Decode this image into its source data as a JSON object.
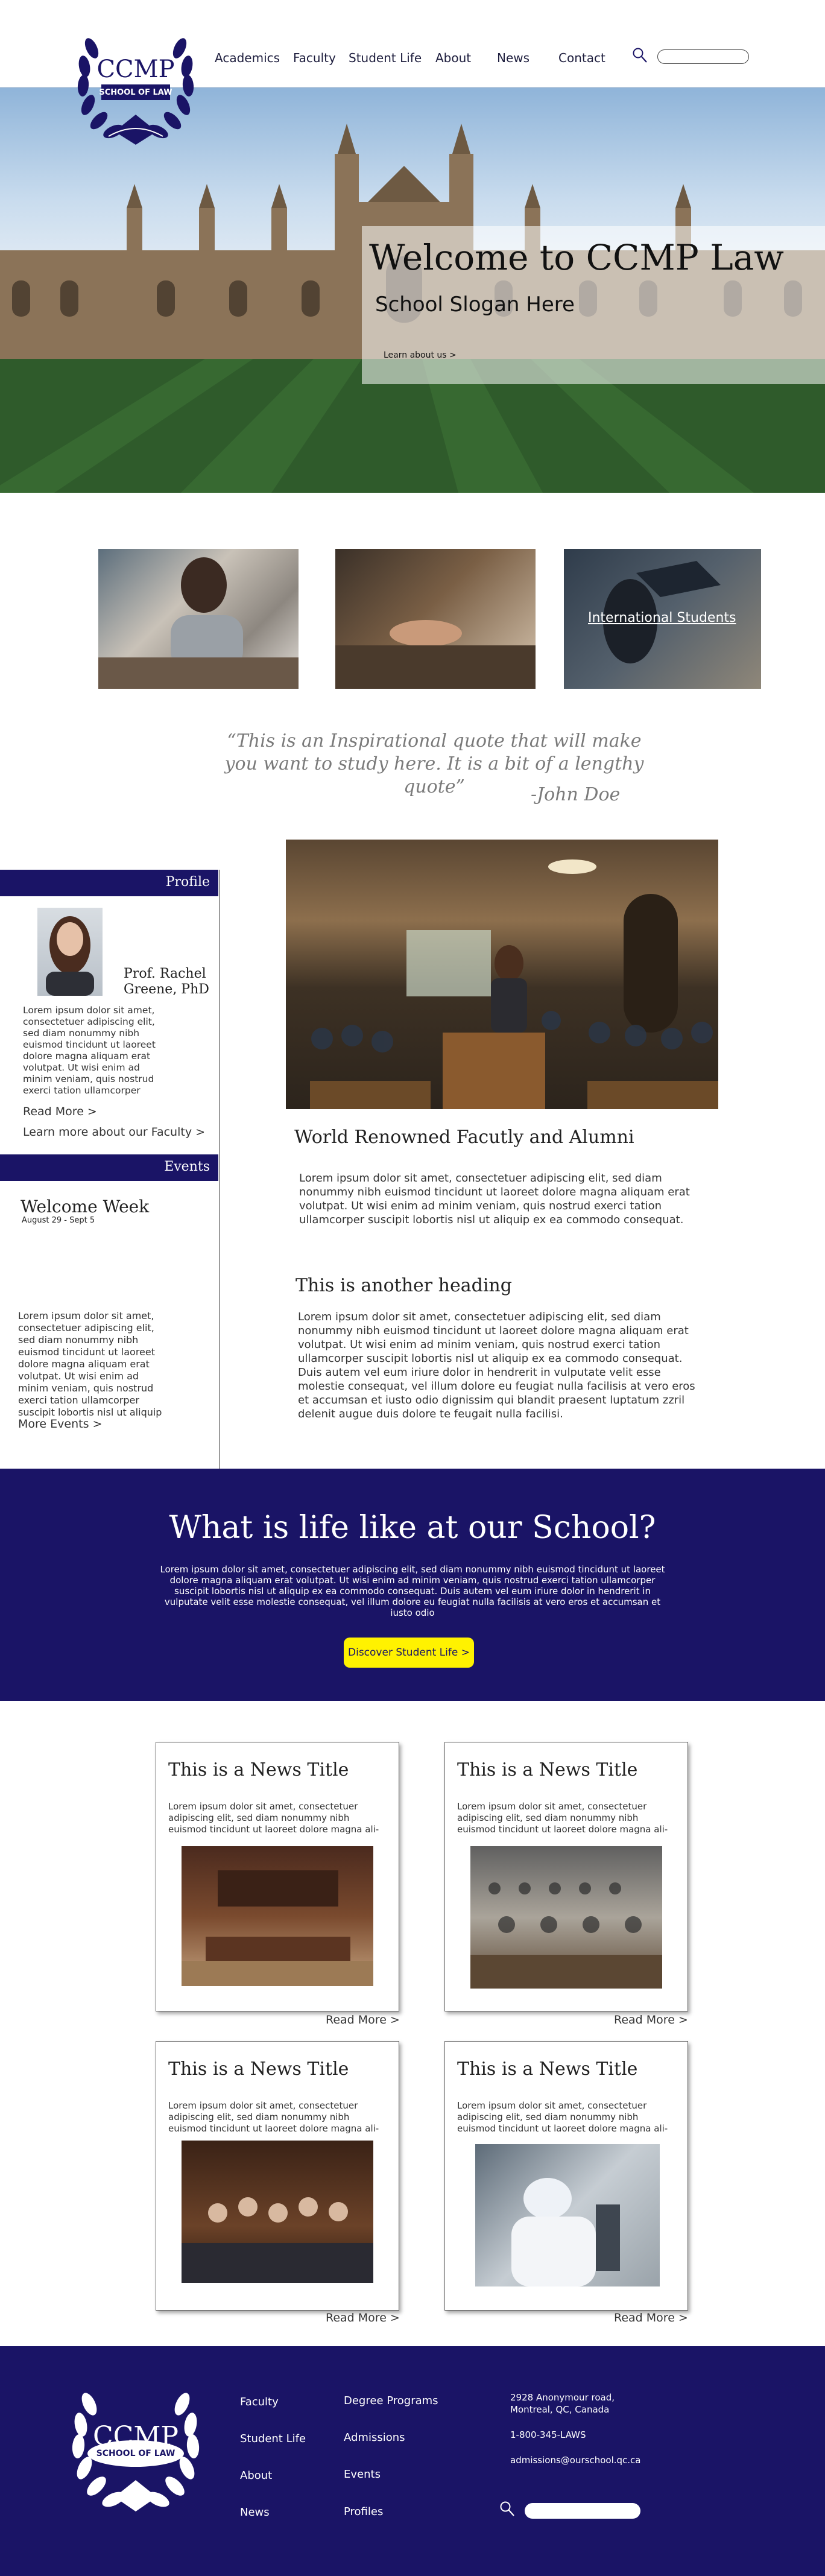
{
  "brand": {
    "name": "CCMP",
    "subtitle": "SCHOOL OF LAW"
  },
  "nav": {
    "items": [
      "Academics",
      "Faculty",
      "Student Life",
      "About",
      "News",
      "Contact"
    ],
    "search_placeholder": ""
  },
  "hero": {
    "title": "Welcome to CCMP Law",
    "slogan": "School Slogan Here",
    "cta": "Learn about us >"
  },
  "features": {
    "international_label": "International Students"
  },
  "quote": {
    "text": "“This is an Inspirational quote that will make you want to study here.  It is a bit of a lengthy quote”",
    "author": "-John Doe"
  },
  "sidebar": {
    "profile_header": "Profile",
    "profile_name": "Prof. Rachel Greene, PhD",
    "profile_text": "Lorem ipsum dolor sit amet, consectetuer adipiscing elit, sed diam nonummy nibh euismod tincidunt ut laoreet dolore magna aliquam erat volutpat. Ut wisi enim ad minim veniam, quis nostrud exerci tation ullamcorper",
    "read_more": "Read More >",
    "faculty_link": "Learn more about our Faculty >",
    "events_header": "Events",
    "event_title": "Welcome Week",
    "event_dates": "August 29 - Sept 5",
    "event_text": "Lorem ipsum dolor sit amet, consectetuer adipiscing elit, sed diam nonummy nibh euismod tincidunt ut laoreet dolore magna aliquam erat volutpat. Ut wisi enim ad minim veniam, quis nostrud exerci tation ullamcorper suscipit lobortis nisl ut aliquip",
    "more_events": "More Events >"
  },
  "main": {
    "heading1": "World Renowned Facutly and Alumni",
    "text1": "Lorem ipsum dolor sit amet, consectetuer adipiscing elit, sed diam nonummy nibh euismod tincidunt ut laoreet dolore magna aliquam erat volutpat. Ut wisi enim ad minim veniam, quis nostrud exerci tation ullamcorper suscipit lobortis nisl ut aliquip ex ea commodo consequat.",
    "heading2": "This is another heading",
    "text2": "Lorem ipsum dolor sit amet, consectetuer adipiscing elit, sed diam nonummy nibh euismod tincidunt ut laoreet dolore magna aliquam erat volutpat. Ut wisi enim ad minim veniam, quis nostrud exerci tation ullamcorper suscipit lobortis nisl ut aliquip ex ea commodo consequat. Duis autem vel eum iriure dolor in hendrerit in vulputate velit esse molestie consequat, vel illum dolore eu feugiat nulla facilisis at vero eros et accumsan et iusto odio dignissim qui blandit praesent luptatum zzril delenit augue duis dolore te feugait nulla facilisi."
  },
  "life": {
    "title": "What is life like at our School?",
    "text": "Lorem ipsum dolor sit amet, consectetuer adipiscing elit, sed diam nonummy nibh euismod tincidunt ut laoreet dolore magna aliquam erat volutpat. Ut wisi enim ad minim veniam, quis nostrud exerci tation ullamcorper suscipit lobortis nisl ut aliquip ex ea commodo consequat. Duis autem vel eum iriure dolor in hendrerit in vulputate velit esse molestie consequat, vel illum dolore eu feugiat nulla facilisis at vero eros et accumsan et iusto odio",
    "button": "Discover Student Life >"
  },
  "news": {
    "items": [
      {
        "title": "This is a News Title",
        "text": "Lorem ipsum dolor sit amet, consectetuer adipiscing elit, sed diam nonummy nibh euismod tincidunt ut laoreet dolore magna ali-",
        "read_more": "Read More >"
      },
      {
        "title": "This is a News Title",
        "text": "Lorem ipsum dolor sit amet, consectetuer adipiscing elit, sed diam nonummy nibh euismod tincidunt ut laoreet dolore magna ali-",
        "read_more": "Read More >"
      },
      {
        "title": "This is a News Title",
        "text": "Lorem ipsum dolor sit amet, consectetuer adipiscing elit, sed diam nonummy nibh euismod tincidunt ut laoreet dolore magna ali-",
        "read_more": "Read More >"
      },
      {
        "title": "This is a News Title",
        "text": "Lorem ipsum dolor sit amet, consectetuer adipiscing elit, sed diam nonummy nibh euismod tincidunt ut laoreet dolore magna ali-",
        "read_more": "Read More >"
      }
    ]
  },
  "footer": {
    "col1": [
      "Faculty",
      "Student Life",
      "About",
      "News"
    ],
    "col2": [
      "Degree Programs",
      "Admissions",
      "Events",
      "Profiles"
    ],
    "address_line1": "2928 Anonymour road,",
    "address_line2": "Montreal, QC, Canada",
    "phone": "1-800-345-LAWS",
    "email": "admissions@ourschool.qc.ca"
  },
  "colors": {
    "navy": "#1a1466",
    "yellow": "#fff200",
    "white": "#ffffff"
  }
}
